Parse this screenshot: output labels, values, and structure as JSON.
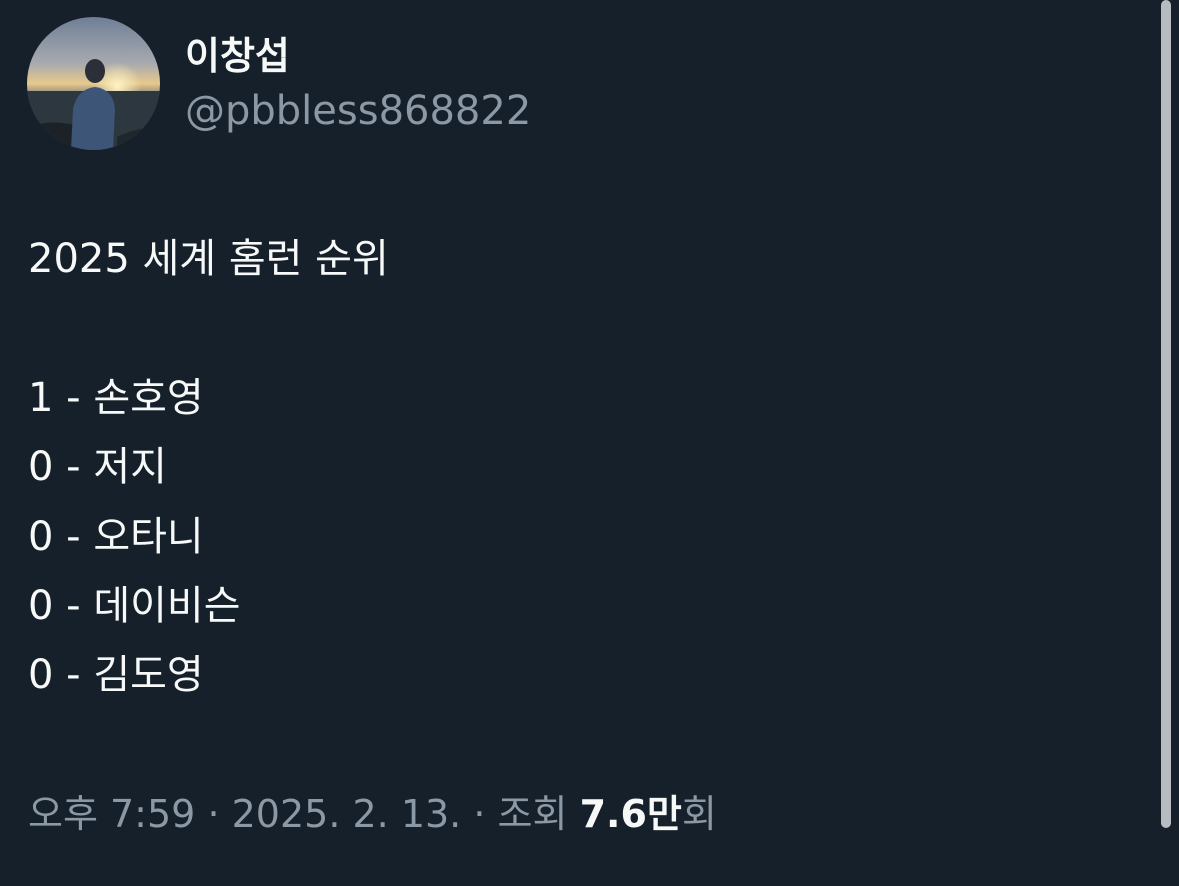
{
  "user": {
    "display_name": "이창섭",
    "handle": "@pbbless868822",
    "avatar_icon": "avatar-photo-sunset-silhouette"
  },
  "tweet": {
    "title_line": "2025 세계 홈런 순위",
    "lines": [
      "1 - 손호영",
      "0 - 저지",
      "0 - 오타니",
      "0 - 데이비슨",
      "0 - 김도영"
    ]
  },
  "meta": {
    "time": "오후 7:59",
    "date": "2025. 2. 13.",
    "separator": "·",
    "views_label": "조회",
    "views_count": "7.6만",
    "views_suffix": "회"
  },
  "colors": {
    "background": "#16202a",
    "primary_text": "#f7f9f9",
    "secondary_text": "#8b98a5"
  }
}
